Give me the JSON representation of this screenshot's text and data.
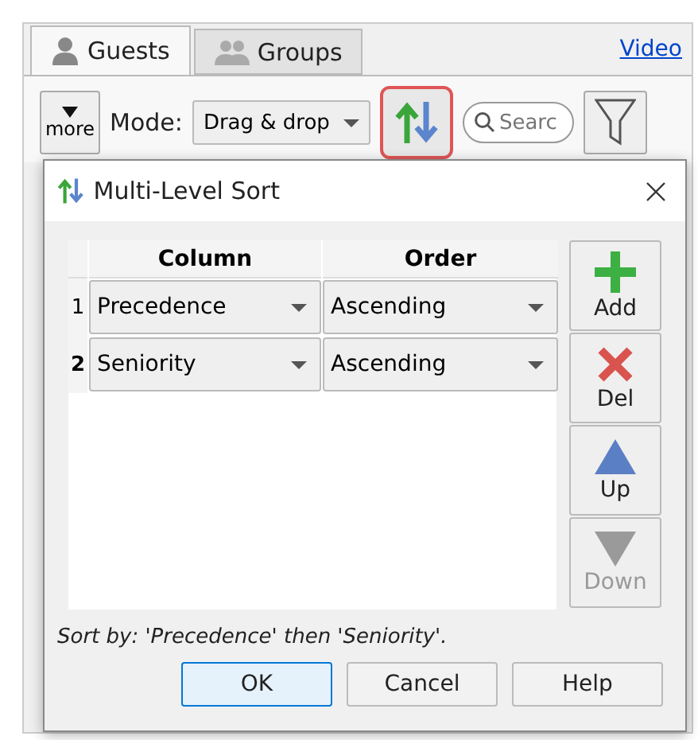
{
  "app": {
    "tabs": [
      {
        "label": "Guests",
        "selected": true
      },
      {
        "label": "Groups",
        "selected": false
      }
    ],
    "video_link": "Video",
    "more_button": "more",
    "mode_label": "Mode:",
    "mode_value": "Drag & drop",
    "sort_button": {
      "highlighted": true
    },
    "search": {
      "placeholder": "Searc"
    }
  },
  "dialog": {
    "title": "Multi-Level Sort",
    "table": {
      "columns": [
        "Column",
        "Order"
      ],
      "rows": [
        {
          "index": "1",
          "column": "Precedence",
          "order": "Ascending",
          "selected": false
        },
        {
          "index": "2",
          "column": "Seniority",
          "order": "Ascending",
          "selected": true
        }
      ]
    },
    "side_buttons": [
      {
        "label": "Add",
        "kind": "add",
        "disabled": false
      },
      {
        "label": "Del",
        "kind": "delete",
        "disabled": false
      },
      {
        "label": "Up",
        "kind": "up",
        "disabled": false
      },
      {
        "label": "Down",
        "kind": "down",
        "disabled": true
      }
    ],
    "summary": "Sort by: 'Precedence' then 'Seniority'.",
    "buttons": [
      {
        "label": "OK",
        "default": true
      },
      {
        "label": "Cancel",
        "default": false
      },
      {
        "label": "Help",
        "default": false
      }
    ]
  }
}
